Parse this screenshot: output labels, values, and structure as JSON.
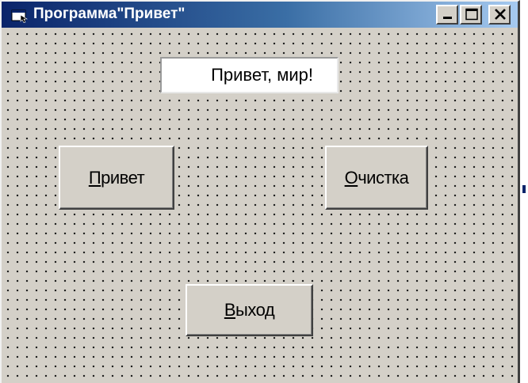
{
  "window": {
    "title": "Программа\"Привет\"",
    "icon": "vb-form-icon",
    "controls": {
      "minimize_icon": "minimize-icon",
      "maximize_icon": "maximize-icon",
      "close_icon": "close-icon"
    }
  },
  "form": {
    "label_text": "Привет, мир!",
    "buttons": {
      "hello": {
        "mnemonic": "П",
        "rest": "ривет"
      },
      "clear": {
        "mnemonic": "О",
        "rest": "чистка"
      },
      "exit": {
        "mnemonic": "В",
        "rest": "ыход"
      }
    }
  },
  "colors": {
    "titlebar_start": "#0a246a",
    "titlebar_end": "#a6caf0",
    "face": "#d4d0c8"
  }
}
